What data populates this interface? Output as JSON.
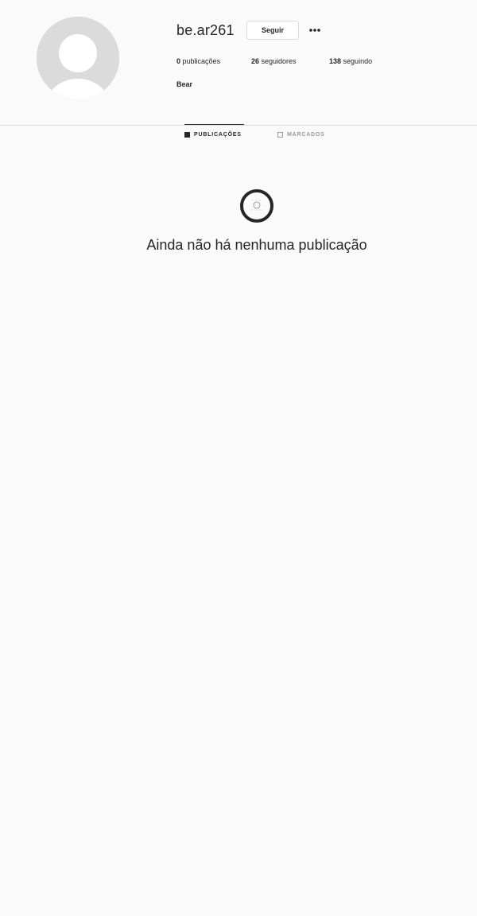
{
  "profile": {
    "username": "be.ar261",
    "full_name": "Bear",
    "follow_label": "Seguir",
    "more_icon": "more-options-icon",
    "avatar_icon": "default-avatar-icon"
  },
  "stats": {
    "posts_count": "0",
    "posts_label": "publicações",
    "followers_count": "26",
    "followers_label": "seguidores",
    "following_count": "138",
    "following_label": "seguindo"
  },
  "tabs": [
    {
      "label": "PUBLICAÇÕES",
      "icon": "grid-icon",
      "active": true
    },
    {
      "label": "MARCADOS",
      "icon": "tagged-icon",
      "active": false
    }
  ],
  "empty_state": {
    "icon": "camera-icon",
    "message": "Ainda não há nenhuma publicação"
  },
  "colors": {
    "background": "#fafafa",
    "text": "#262626",
    "muted": "#999999",
    "border": "#dbdbdb"
  }
}
